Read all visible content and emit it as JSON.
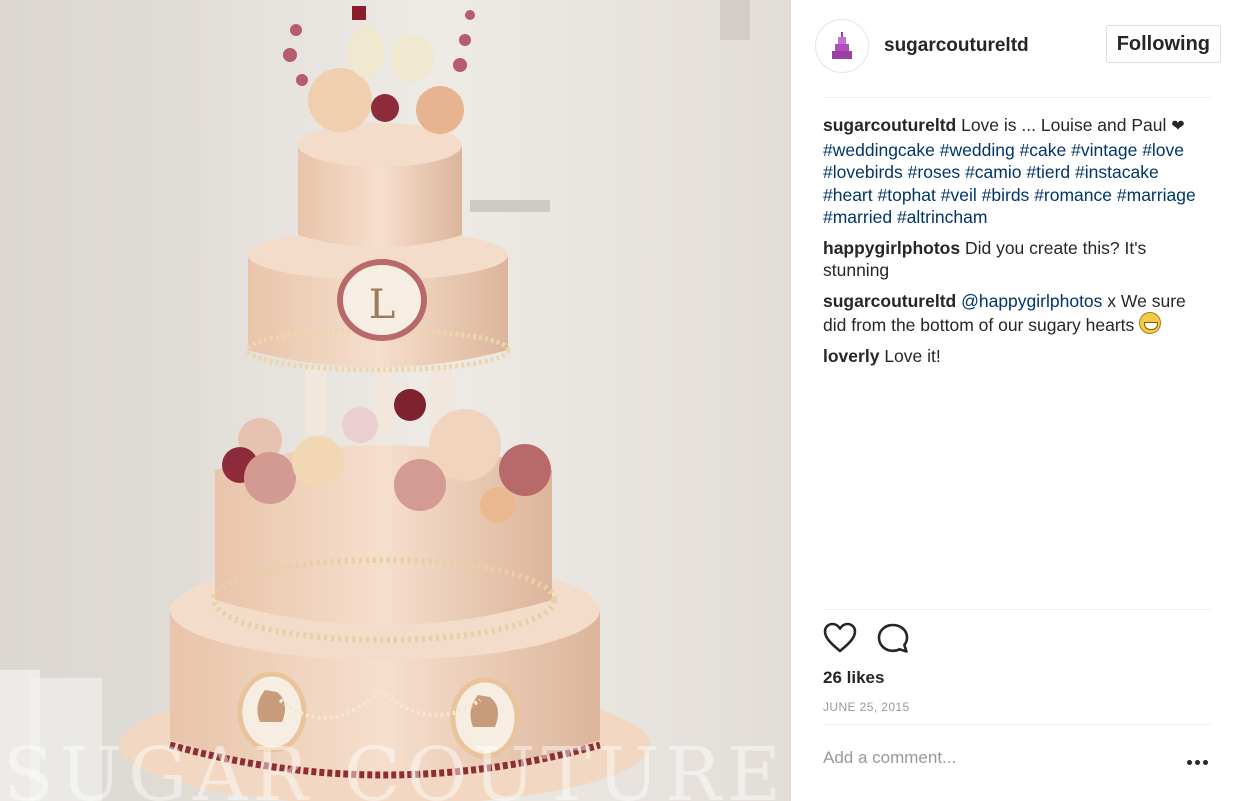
{
  "photo": {
    "watermark": "SUGAR COUTURE",
    "alt": ""
  },
  "header": {
    "username": "sugarcoutureltd",
    "follow_label": "Following"
  },
  "caption": {
    "user": "sugarcoutureltd",
    "text": "Love is ... Louise and Paul",
    "heart": "❤",
    "hashtags": [
      "#weddingcake",
      "#wedding",
      "#cake",
      "#vintage",
      "#love",
      "#lovebirds",
      "#roses",
      "#camio",
      "#tierd",
      "#instacake",
      "#heart",
      "#tophat",
      "#veil",
      "#birds",
      "#romance",
      "#marriage",
      "#married",
      "#altrincham"
    ]
  },
  "comments": [
    {
      "user": "happygirlphotos",
      "text": "Did you create this? It's stunning"
    },
    {
      "user": "sugarcoutureltd",
      "mention": "@happygirlphotos",
      "text": "x We sure did from the bottom of our sugary hearts"
    },
    {
      "user": "loverly",
      "text": "Love it!"
    }
  ],
  "footer": {
    "likes": "26 likes",
    "date": "JUNE 25, 2015",
    "comment_placeholder": "Add a comment..."
  }
}
